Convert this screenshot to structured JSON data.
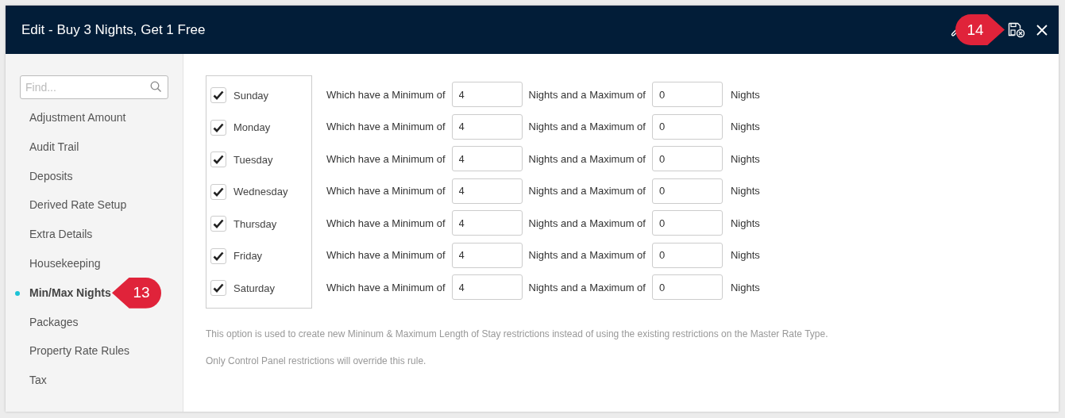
{
  "window": {
    "title": "Edit - Buy 3 Nights, Get 1 Free",
    "callout": "14"
  },
  "sidebar": {
    "search": {
      "placeholder": "Find..."
    },
    "items": [
      {
        "label": "Adjustment Amount",
        "selected": false
      },
      {
        "label": "Audit Trail",
        "selected": false
      },
      {
        "label": "Deposits",
        "selected": false
      },
      {
        "label": "Derived Rate Setup",
        "selected": false
      },
      {
        "label": "Extra Details",
        "selected": false
      },
      {
        "label": "Housekeeping",
        "selected": false
      },
      {
        "label": "Min/Max Nights",
        "selected": true,
        "callout": "13"
      },
      {
        "label": "Packages",
        "selected": false
      },
      {
        "label": "Property Rate Rules",
        "selected": false
      },
      {
        "label": "Tax",
        "selected": false
      }
    ]
  },
  "days": [
    {
      "label": "Sunday",
      "checked": true,
      "min_label": "Which have a Minimum of",
      "min": "4",
      "max_label": "Nights and a Maximum of",
      "max": "0",
      "unit": "Nights"
    },
    {
      "label": "Monday",
      "checked": true,
      "min_label": "Which have a Minimum of",
      "min": "4",
      "max_label": "Nights and a Maximum of",
      "max": "0",
      "unit": "Nights"
    },
    {
      "label": "Tuesday",
      "checked": true,
      "min_label": "Which have a Minimum of",
      "min": "4",
      "max_label": "Nights and a Maximum of",
      "max": "0",
      "unit": "Nights"
    },
    {
      "label": "Wednesday",
      "checked": true,
      "min_label": "Which have a Minimum of",
      "min": "4",
      "max_label": "Nights and a Maximum of",
      "max": "0",
      "unit": "Nights"
    },
    {
      "label": "Thursday",
      "checked": true,
      "min_label": "Which have a Minimum of",
      "min": "4",
      "max_label": "Nights and a Maximum of",
      "max": "0",
      "unit": "Nights"
    },
    {
      "label": "Friday",
      "checked": true,
      "min_label": "Which have a Minimum of",
      "min": "4",
      "max_label": "Nights and a Maximum of",
      "max": "0",
      "unit": "Nights"
    },
    {
      "label": "Saturday",
      "checked": true,
      "min_label": "Which have a Minimum of",
      "min": "4",
      "max_label": "Nights and a Maximum of",
      "max": "0",
      "unit": "Nights"
    }
  ],
  "notes": [
    "This option is used to create new Mininum & Maximum Length of Stay restrictions instead of using the existing restrictions on the Master Rate Type.",
    "Only Control Panel restrictions will override this rule."
  ]
}
